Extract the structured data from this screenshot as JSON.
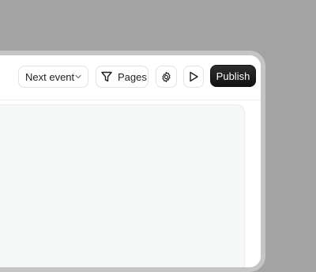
{
  "toolbar": {
    "event_selector": {
      "label": "Next event",
      "icon": "chevron-down-icon"
    },
    "pages_button": {
      "label": "Pages",
      "icon": "filter-icon"
    },
    "settings_button": {
      "icon": "gear-icon"
    },
    "preview_button": {
      "icon": "play-icon"
    },
    "publish_button": {
      "label": "Publish"
    }
  },
  "colors": {
    "backdrop": "#a3a3a3",
    "publish_bg": "#1a1a1a",
    "canvas_bg": "#f6f7f7"
  }
}
